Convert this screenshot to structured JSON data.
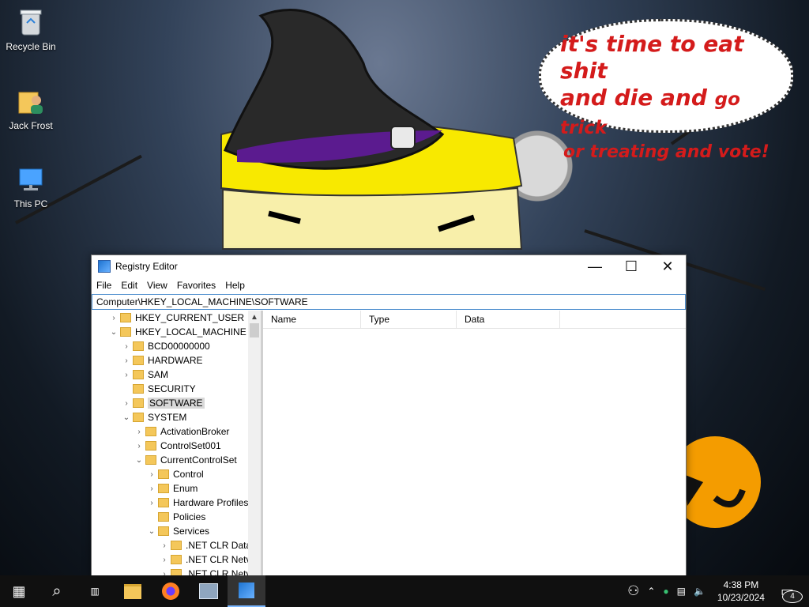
{
  "desktop": {
    "icons": [
      {
        "label": "Recycle Bin",
        "icon": "recycle-bin-icon"
      },
      {
        "label": "Jack Frost",
        "icon": "user-folder-icon"
      },
      {
        "label": "This PC",
        "icon": "computer-icon"
      }
    ],
    "speech_bubble": {
      "line1": "it's time to eat shit",
      "line2_main": "and die and",
      "line2_small": "go trick",
      "line3": "or treating and vote!"
    },
    "colors": {
      "bubble_text": "#d41b1b",
      "hat_band": "#5b1b8f",
      "face": "#f7ea00"
    }
  },
  "window": {
    "title": "Registry Editor",
    "controls": {
      "minimize": "—",
      "maximize": "☐",
      "close": "✕"
    },
    "menu": [
      "File",
      "Edit",
      "View",
      "Favorites",
      "Help"
    ],
    "address": "Computer\\HKEY_LOCAL_MACHINE\\SOFTWARE",
    "tree": [
      {
        "label": "HKEY_CURRENT_USER",
        "depth": 1,
        "expander": "›"
      },
      {
        "label": "HKEY_LOCAL_MACHINE",
        "depth": 1,
        "expander": "⌄"
      },
      {
        "label": "BCD00000000",
        "depth": 2,
        "expander": "›"
      },
      {
        "label": "HARDWARE",
        "depth": 2,
        "expander": "›"
      },
      {
        "label": "SAM",
        "depth": 2,
        "expander": "›"
      },
      {
        "label": "SECURITY",
        "depth": 2,
        "expander": ""
      },
      {
        "label": "SOFTWARE",
        "depth": 2,
        "expander": "›",
        "selected": true
      },
      {
        "label": "SYSTEM",
        "depth": 2,
        "expander": "⌄"
      },
      {
        "label": "ActivationBroker",
        "depth": 3,
        "expander": "›"
      },
      {
        "label": "ControlSet001",
        "depth": 3,
        "expander": "›"
      },
      {
        "label": "CurrentControlSet",
        "depth": 3,
        "expander": "⌄"
      },
      {
        "label": "Control",
        "depth": 4,
        "expander": "›"
      },
      {
        "label": "Enum",
        "depth": 4,
        "expander": "›"
      },
      {
        "label": "Hardware Profiles",
        "depth": 4,
        "expander": "›"
      },
      {
        "label": "Policies",
        "depth": 4,
        "expander": ""
      },
      {
        "label": "Services",
        "depth": 4,
        "expander": "⌄"
      },
      {
        "label": ".NET CLR Data",
        "depth": 5,
        "expander": "›"
      },
      {
        "label": ".NET CLR Netv",
        "depth": 5,
        "expander": "›"
      },
      {
        "label": ".NET CLR Netv",
        "depth": 5,
        "expander": "›"
      }
    ],
    "columns": [
      "Name",
      "Type",
      "Data"
    ]
  },
  "taskbar": {
    "time": "4:38 PM",
    "date": "10/23/2024",
    "notification_count": "4",
    "apps": [
      "start-icon",
      "search-icon",
      "task-view-icon",
      "file-explorer-icon",
      "firefox-icon",
      "app-icon",
      "registry-editor-icon"
    ]
  }
}
